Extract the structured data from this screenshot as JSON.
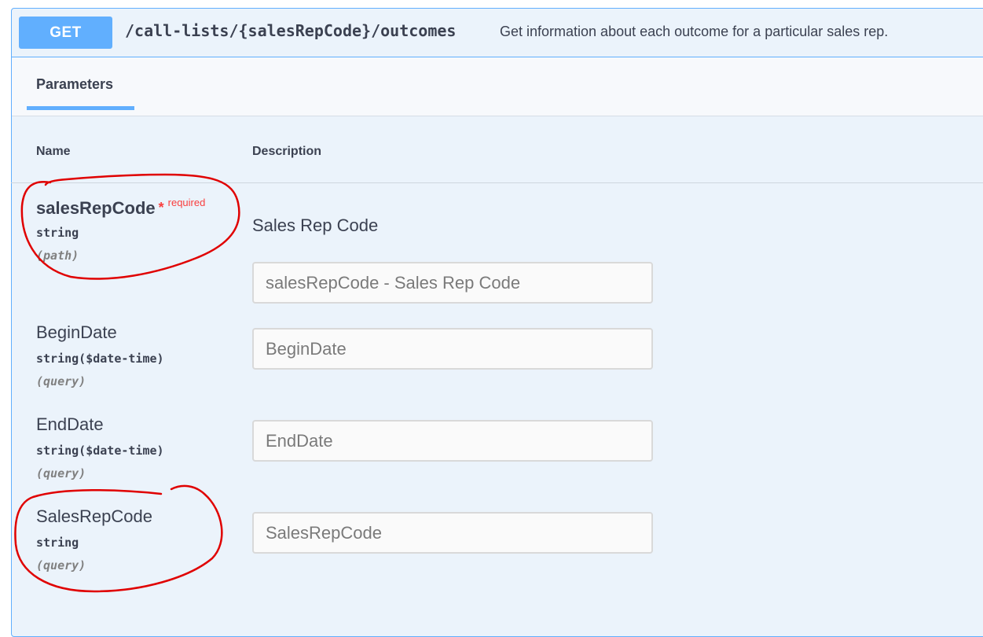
{
  "operation": {
    "method": "GET",
    "path": "/call-lists/{salesRepCode}/outcomes",
    "summary": "Get information about each outcome for a particular sales rep."
  },
  "tabs": {
    "parameters": "Parameters"
  },
  "table": {
    "name_header": "Name",
    "description_header": "Description"
  },
  "params": [
    {
      "name": "salesRepCode",
      "required_star": "*",
      "required_label": "required",
      "type": "string",
      "in": "(path)",
      "description": "Sales Rep Code",
      "placeholder": "salesRepCode - Sales Rep Code",
      "value": ""
    },
    {
      "name": "BeginDate",
      "type": "string($date-time)",
      "in": "(query)",
      "placeholder": "BeginDate",
      "value": ""
    },
    {
      "name": "EndDate",
      "type": "string($date-time)",
      "in": "(query)",
      "placeholder": "EndDate",
      "value": ""
    },
    {
      "name": "SalesRepCode",
      "type": "string",
      "in": "(query)",
      "placeholder": "SalesRepCode",
      "value": ""
    }
  ],
  "colors": {
    "get_accent": "#61affe",
    "block_background": "#ebf3fb",
    "required": "#f93e3e",
    "annotation": "#e00000"
  }
}
